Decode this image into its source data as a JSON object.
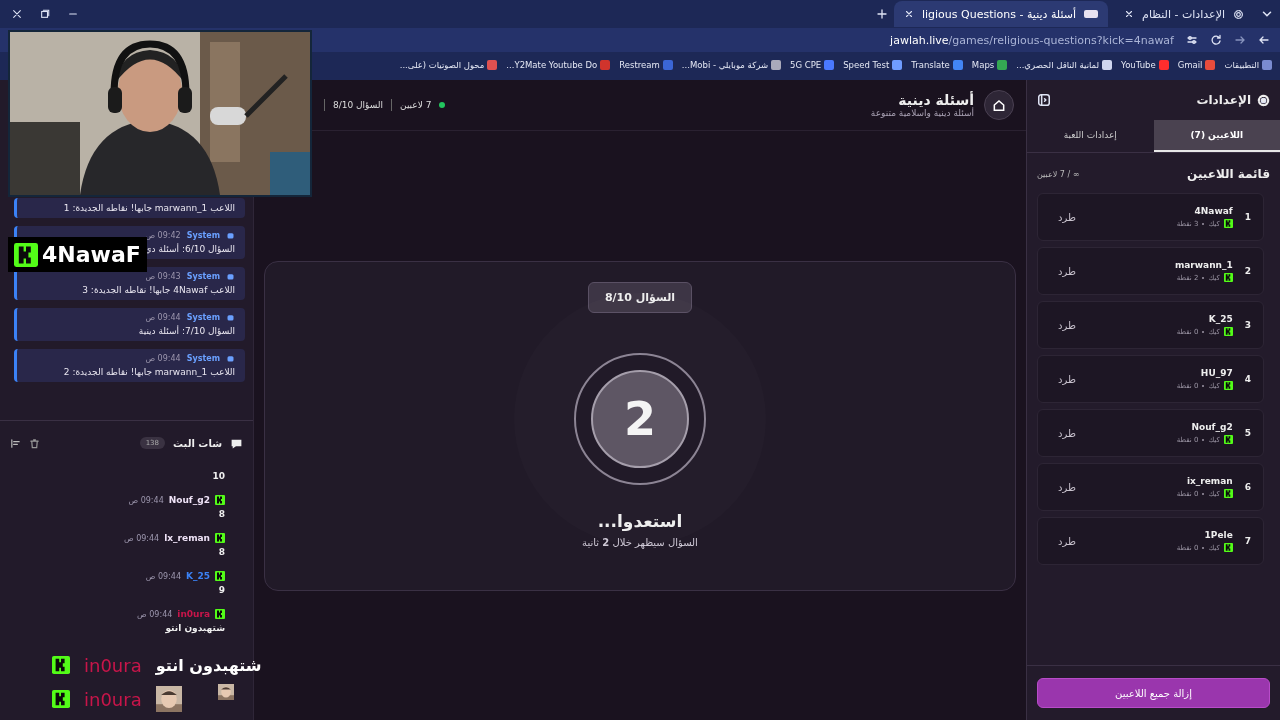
{
  "browser": {
    "tabs": [
      {
        "title": "الإعدادات - النظام",
        "selected": false
      },
      {
        "title": "أسئلة دينية - ligious Questions",
        "selected": true
      }
    ],
    "url": {
      "host": "jawlah.live",
      "path": "/games/religious-questions?kick=4nawaf"
    },
    "bookmarks": [
      "التطبيقات",
      "Gmail",
      "YouTube",
      "لمانية الناقل الحصري...",
      "Maps",
      "Translate",
      "Speed Test",
      "5G CPE",
      "شركة موبايلي - Mobi...",
      "Restream",
      "Y2Mate Youtube Do...",
      "محول الصوتيات (على..."
    ]
  },
  "chat_panel": {
    "system_messages": [
      {
        "text": "اللاعب marwann_1 جابها! نقاطه الجديدة: 1"
      },
      {
        "author": "System",
        "time": "09:42 ص",
        "text": "السؤال 6/10: أسئلة دي"
      },
      {
        "author": "System",
        "time": "09:43 ص",
        "text": "اللاعب 4Nawaf جابها! نقاطه الجديدة: 3"
      },
      {
        "author": "System",
        "time": "09:44 ص",
        "text": "السؤال 7/10: أسئلة دينية"
      },
      {
        "author": "System",
        "time": "09:44 ص",
        "text": "اللاعب marwann_1 جابها! نقاطه الجديدة: 2"
      }
    ],
    "title": "شات البث",
    "count": "138",
    "messages": [
      {
        "text": "10"
      },
      {
        "user": "Nouf_g2",
        "color": "#efe3f7",
        "time": "09:44 ص",
        "text": "8"
      },
      {
        "user": "lx_reman",
        "color": "#efe3f7",
        "time": "09:44 ص",
        "text": "8"
      },
      {
        "user": "K_25",
        "color": "#3b82f6",
        "time": "09:44 ص",
        "text": "9"
      },
      {
        "user": "in0ura",
        "color": "#c8154a",
        "time": "09:44 ص",
        "text": "شتهبدون انتو"
      }
    ]
  },
  "stream_overlay": {
    "streamer_tag": "4NawaF",
    "alerts": [
      {
        "kind": "text",
        "user": "in0ura",
        "text": "شتهبدون انتو"
      },
      {
        "kind": "emote",
        "user": "in0ura"
      }
    ]
  },
  "game": {
    "title": "أسئلة دينية",
    "subtitle": "أسئلة دينية واسلامية متنوعة",
    "players_count": "7 لاعبين",
    "question": "السؤال 8/10",
    "card": {
      "badge": "السؤال 8/10",
      "countdown": "2",
      "heading": "استعدوا...",
      "note": "السؤال سيظهر خلال **2** ثانية"
    }
  },
  "settings": {
    "title": "الإعدادات",
    "tabs": [
      {
        "label": "اللاعبين (7)",
        "selected": true
      },
      {
        "label": "إعدادات اللعبة",
        "selected": false
      }
    ],
    "list_title": "قائمة اللاعبين",
    "capacity": "∞ / 7 لاعبين",
    "players": [
      {
        "rank": "1",
        "name": "4Nawaf",
        "platform": "كيك",
        "points": "3 نقطة",
        "action": "طرد"
      },
      {
        "rank": "2",
        "name": "marwann_1",
        "platform": "كيك",
        "points": "2 نقطة",
        "action": "طرد"
      },
      {
        "rank": "3",
        "name": "K_25",
        "platform": "كيك",
        "points": "0 نقطة",
        "action": "طرد"
      },
      {
        "rank": "4",
        "name": "HU_97",
        "platform": "كيك",
        "points": "0 نقطة",
        "action": "طرد"
      },
      {
        "rank": "5",
        "name": "Nouf_g2",
        "platform": "كيك",
        "points": "0 نقطة",
        "action": "طرد"
      },
      {
        "rank": "6",
        "name": "ix_reman",
        "platform": "كيك",
        "points": "0 نقطة",
        "action": "طرد"
      },
      {
        "rank": "7",
        "name": "1Pele",
        "platform": "كيك",
        "points": "0 نقطة",
        "action": "طرد"
      }
    ],
    "remove_all": "إزالة جميع اللاعبين"
  }
}
